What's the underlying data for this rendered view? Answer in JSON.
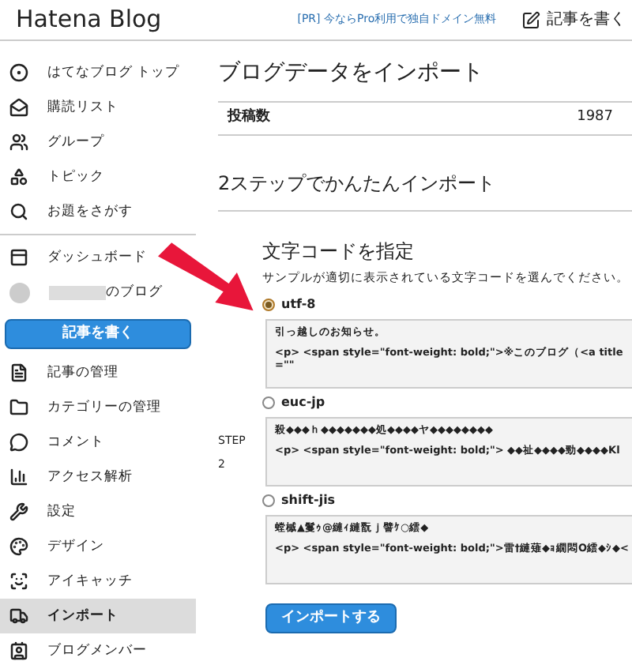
{
  "header": {
    "logo": "Hatena Blog",
    "promo": "[PR] 今ならPro利用で独自ドメイン無料",
    "write_link": "記事を書く"
  },
  "sidebar": {
    "top_items": [
      {
        "label": "はてなブログ トップ",
        "selected": false
      },
      {
        "label": "購読リスト",
        "selected": false
      },
      {
        "label": "グループ",
        "selected": false
      },
      {
        "label": "トピック",
        "selected": false
      },
      {
        "label": "お題をさがす",
        "selected": false
      }
    ],
    "dashboard": "ダッシュボード",
    "blog_name": "のブログ",
    "write_button": "記事を書く",
    "items": [
      {
        "label": "記事の管理",
        "selected": false
      },
      {
        "label": "カテゴリーの管理",
        "selected": false
      },
      {
        "label": "コメント",
        "selected": false
      },
      {
        "label": "アクセス解析",
        "selected": false
      },
      {
        "label": "設定",
        "selected": false
      },
      {
        "label": "デザイン",
        "selected": false
      },
      {
        "label": "アイキャッチ",
        "selected": false
      },
      {
        "label": "インポート",
        "selected": true
      },
      {
        "label": "ブログメンバー",
        "selected": false
      }
    ]
  },
  "main": {
    "title": "ブログデータをインポート",
    "stats": [
      {
        "label": "投稿数",
        "value": "1987"
      }
    ],
    "subtitle": "2ステップでかんたんインポート",
    "step_label": "STEP",
    "step_number": "2",
    "section_title": "文字コードを指定",
    "description": "サンプルが適切に表示されている文字コードを選んでください。",
    "encodings": [
      {
        "label": "utf-8",
        "selected": true,
        "sample": [
          "引っ越しのお知らせ。",
          "<p> <span style=\"font-weight: bold;\">※このブログ（<a title=\"\""
        ]
      },
      {
        "label": "euc-jp",
        "selected": false,
        "sample": [
          "殺◆◆◆ｈ◆◆◆◆◆◆◆処◆◆◆◆ヤ◆◆◆◆◆◆◆◆",
          "<p> <span style=\"font-weight: bold;\"> ◆◆祉◆◆◆◆勁◆◆◆◆Kl"
        ]
      },
      {
        "label": "shift-jis",
        "selected": false,
        "sample": [
          "螳槭▲鬘ｩ@縺ｨ縺翫ｊ譬ｹ○繧◆",
          "<p> <span style=\"font-weight: bold;\">雷†縺薙◆ｮ繝悶Ο繧◆ｼ◆<"
        ]
      }
    ],
    "import_button": "インポートする"
  }
}
